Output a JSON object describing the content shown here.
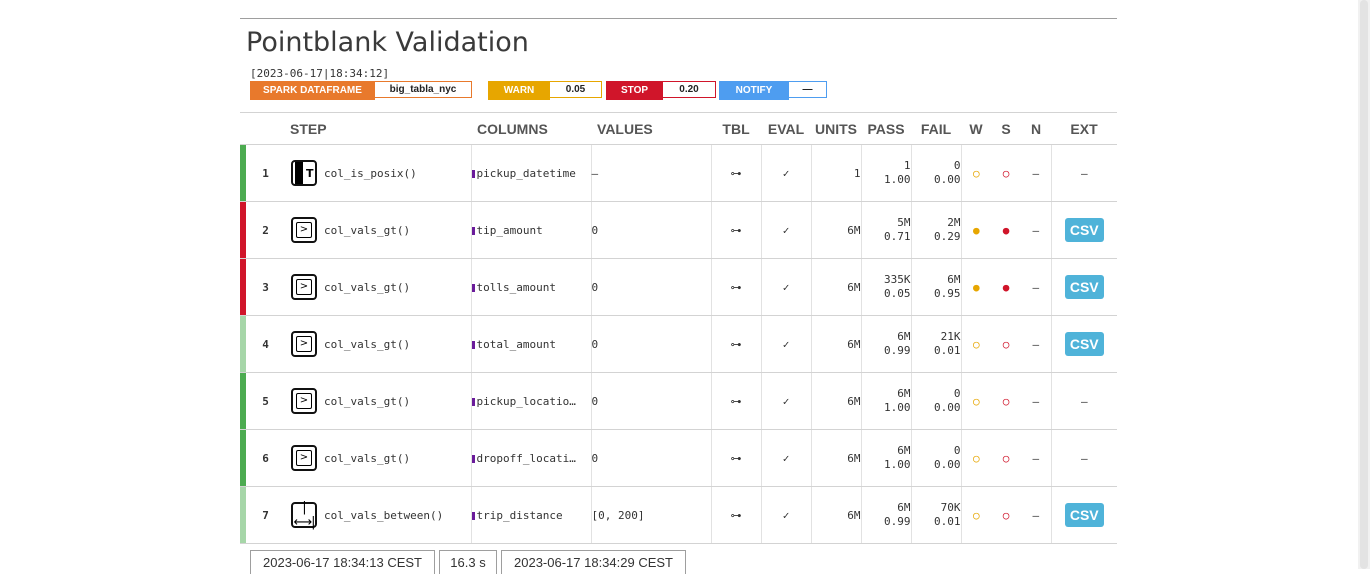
{
  "report": {
    "title": "Pointblank Validation",
    "date": "[2023-06-17|18:34:12]",
    "table_type": "SPARK DATAFRAME",
    "table_name": "big_tabla_nyc",
    "thresholds": {
      "warn_label": "WARN",
      "warn_value": "0.05",
      "stop_label": "STOP",
      "stop_value": "0.20",
      "notify_label": "NOTIFY",
      "notify_value": "—"
    }
  },
  "colors": {
    "spark": "#e8792c",
    "warn": "#e7a600",
    "stop": "#d0152a",
    "notify": "#4e9df0",
    "pass_stripe": "#4cab50",
    "fail_stripe": "#d0152a",
    "light_stripe": "#a6d6a8",
    "csv": "#4fb3d9",
    "check": "#2e8b3d"
  },
  "columns": {
    "step": "STEP",
    "columns": "COLUMNS",
    "values": "VALUES",
    "tbl": "TBL",
    "eval": "EVAL",
    "units": "UNITS",
    "pass": "PASS",
    "fail": "FAIL",
    "w": "W",
    "s": "S",
    "n": "N",
    "ext": "EXT"
  },
  "rows": [
    {
      "num": "1",
      "icon": "posix-icon",
      "step": "col_is_posix()",
      "column": "pickup_datetime",
      "values": "—",
      "tbl": "⊶",
      "eval": "✓",
      "units": "1",
      "pass_n": "1",
      "pass_f": "1.00",
      "fail_n": "0",
      "fail_f": "0.00",
      "w": "○",
      "s": "○",
      "n": "—",
      "ext": "—",
      "status": "pass"
    },
    {
      "num": "2",
      "icon": "gt-icon",
      "step": "col_vals_gt()",
      "column": "tip_amount",
      "values": "0",
      "tbl": "⊶",
      "eval": "✓",
      "units": "6M",
      "pass_n": "5M",
      "pass_f": "0.71",
      "fail_n": "2M",
      "fail_f": "0.29",
      "w": "●",
      "s": "●",
      "n": "—",
      "ext": "CSV",
      "status": "fail"
    },
    {
      "num": "3",
      "icon": "gt-icon",
      "step": "col_vals_gt()",
      "column": "tolls_amount",
      "values": "0",
      "tbl": "⊶",
      "eval": "✓",
      "units": "6M",
      "pass_n": "335K",
      "pass_f": "0.05",
      "fail_n": "6M",
      "fail_f": "0.95",
      "w": "●",
      "s": "●",
      "n": "—",
      "ext": "CSV",
      "status": "fail"
    },
    {
      "num": "4",
      "icon": "gt-icon",
      "step": "col_vals_gt()",
      "column": "total_amount",
      "values": "0",
      "tbl": "⊶",
      "eval": "✓",
      "units": "6M",
      "pass_n": "6M",
      "pass_f": "0.99",
      "fail_n": "21K",
      "fail_f": "0.01",
      "w": "○",
      "s": "○",
      "n": "—",
      "ext": "CSV",
      "status": "light"
    },
    {
      "num": "5",
      "icon": "gt-icon",
      "step": "col_vals_gt()",
      "column": "pickup_locatio…",
      "values": "0",
      "tbl": "⊶",
      "eval": "✓",
      "units": "6M",
      "pass_n": "6M",
      "pass_f": "1.00",
      "fail_n": "0",
      "fail_f": "0.00",
      "w": "○",
      "s": "○",
      "n": "—",
      "ext": "—",
      "status": "pass"
    },
    {
      "num": "6",
      "icon": "gt-icon",
      "step": "col_vals_gt()",
      "column": "dropoff_locati…",
      "values": "0",
      "tbl": "⊶",
      "eval": "✓",
      "units": "6M",
      "pass_n": "6M",
      "pass_f": "1.00",
      "fail_n": "0",
      "fail_f": "0.00",
      "w": "○",
      "s": "○",
      "n": "—",
      "ext": "—",
      "status": "pass"
    },
    {
      "num": "7",
      "icon": "between-icon",
      "step": "col_vals_between()",
      "column": "trip_distance",
      "values": "[0, 200]",
      "tbl": "⊶",
      "eval": "✓",
      "units": "6M",
      "pass_n": "6M",
      "pass_f": "0.99",
      "fail_n": "70K",
      "fail_f": "0.01",
      "w": "○",
      "s": "○",
      "n": "—",
      "ext": "CSV",
      "status": "light"
    }
  ],
  "footer": {
    "start": "2023-06-17 18:34:13 CEST",
    "duration": "16.3 s",
    "end": "2023-06-17 18:34:29 CEST"
  }
}
